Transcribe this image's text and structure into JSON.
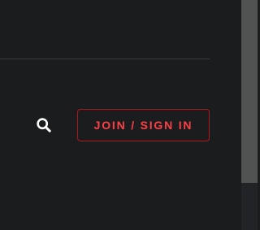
{
  "header": {
    "search_icon": "search-icon",
    "join_label": "JOIN / SIGN IN"
  },
  "colors": {
    "background": "#1b1c1e",
    "accent": "#ff3f46",
    "accent_border": "#b2161c",
    "divider": "#3a3b3d",
    "scrollbar_thumb": "#505352"
  }
}
